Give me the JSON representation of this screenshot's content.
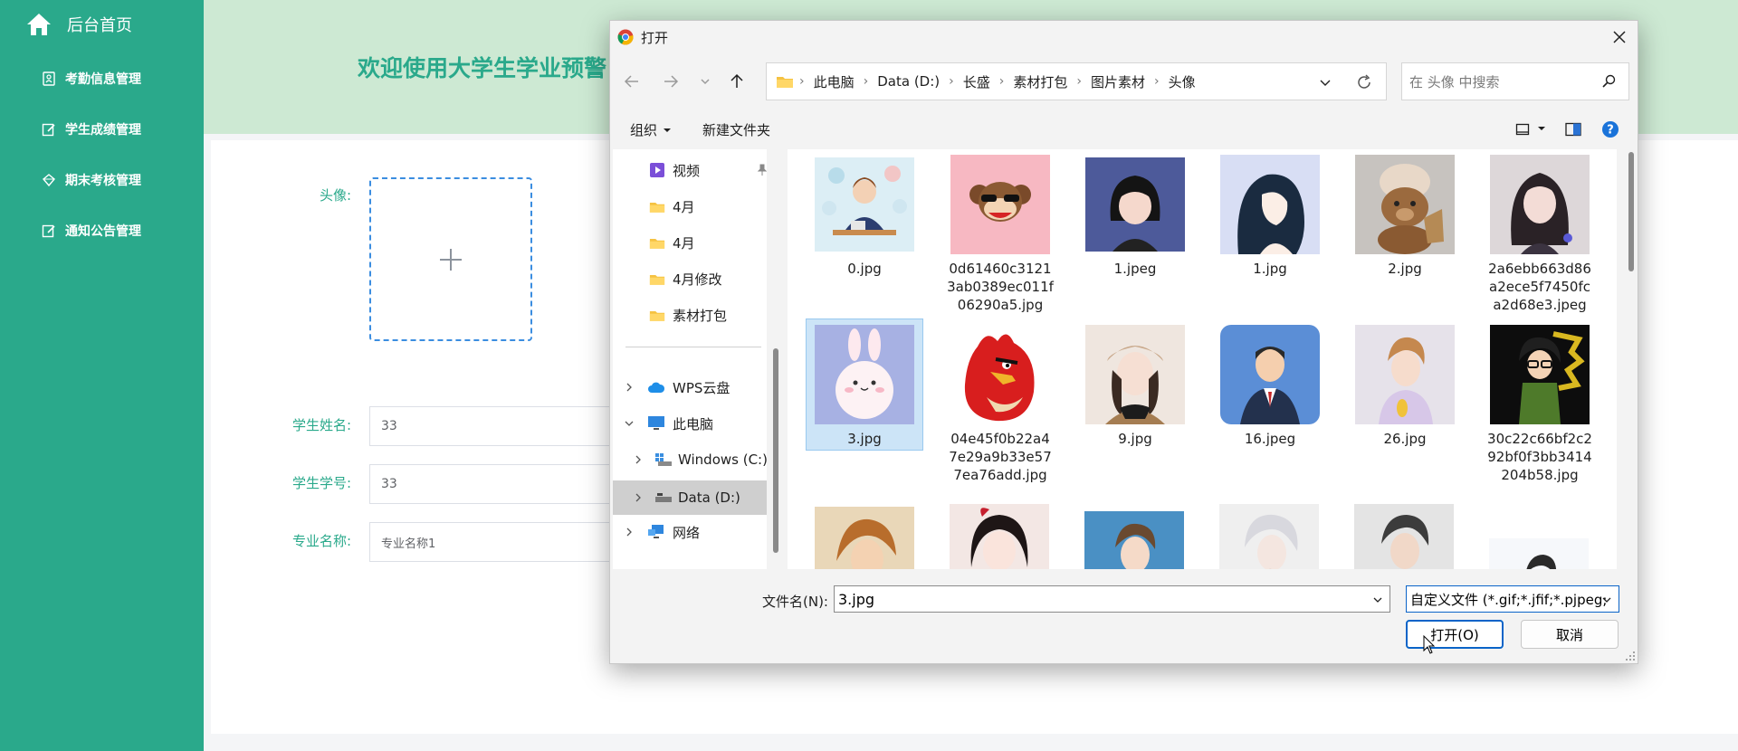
{
  "sidebar": {
    "home_label": "后台首页",
    "items": [
      {
        "label": "考勤信息管理",
        "icon": "id-card-icon"
      },
      {
        "label": "学生成绩管理",
        "icon": "edit-icon"
      },
      {
        "label": "期末考核管理",
        "icon": "diamond-icon"
      },
      {
        "label": "通知公告管理",
        "icon": "edit-icon"
      }
    ]
  },
  "header": {
    "welcome": "欢迎使用大学生学业预警"
  },
  "form": {
    "avatar_label": "头像:",
    "name_label": "学生姓名:",
    "name_value": "33",
    "id_label": "学生学号:",
    "id_value": "33",
    "major_label": "专业名称:",
    "major_value": "专业名称1"
  },
  "dialog": {
    "title": "打开",
    "breadcrumbs": [
      "此电脑",
      "Data (D:)",
      "长盛",
      "素材打包",
      "图片素材",
      "头像"
    ],
    "search_placeholder": "在 头像 中搜索",
    "organize_label": "组织",
    "new_folder_label": "新建文件夹",
    "nav_tree": [
      {
        "label": "视频",
        "type": "video",
        "pinned": true
      },
      {
        "label": "4月",
        "type": "folder"
      },
      {
        "label": "4月",
        "type": "folder"
      },
      {
        "label": "4月修改",
        "type": "folder"
      },
      {
        "label": "素材打包",
        "type": "folder"
      },
      {
        "label": "WPS云盘",
        "type": "cloud",
        "expander": "collapsed"
      },
      {
        "label": "此电脑",
        "type": "pc",
        "expander": "expanded"
      },
      {
        "label": "Windows (C:)",
        "type": "drive",
        "expander": "collapsed"
      },
      {
        "label": "Data (D:)",
        "type": "drive",
        "expander": "collapsed",
        "selected": true
      },
      {
        "label": "网络",
        "type": "network",
        "expander": "collapsed"
      }
    ],
    "files": [
      {
        "name": "0.jpg"
      },
      {
        "name": "0d61460c31213ab0389ec011f06290a5.jpg"
      },
      {
        "name": "1.jpeg"
      },
      {
        "name": "1.jpg"
      },
      {
        "name": "2.jpg"
      },
      {
        "name": "2a6ebb663d86a2ece5f7450fca2d68e3.jpeg"
      },
      {
        "name": "3.jpg",
        "selected": true
      },
      {
        "name": "04e45f0b22a47e29a9b33e577ea76add.jpg"
      },
      {
        "name": "9.jpg"
      },
      {
        "name": "16.jpeg"
      },
      {
        "name": "26.jpg"
      },
      {
        "name": "30c22c66bf2c292bf0f3bb3414204b58.jpg"
      }
    ],
    "filename_label": "文件名(N):",
    "filename_value": "3.jpg",
    "filetype_value": "自定义文件 (*.gif;*.jfif;*.pjpeg;",
    "open_label": "打开(O)",
    "cancel_label": "取消"
  },
  "colors": {
    "accent": "#2aa98b",
    "header_bg": "#cde9d3",
    "selection": "#cce4f7",
    "primary_button": "#0a64c8"
  }
}
